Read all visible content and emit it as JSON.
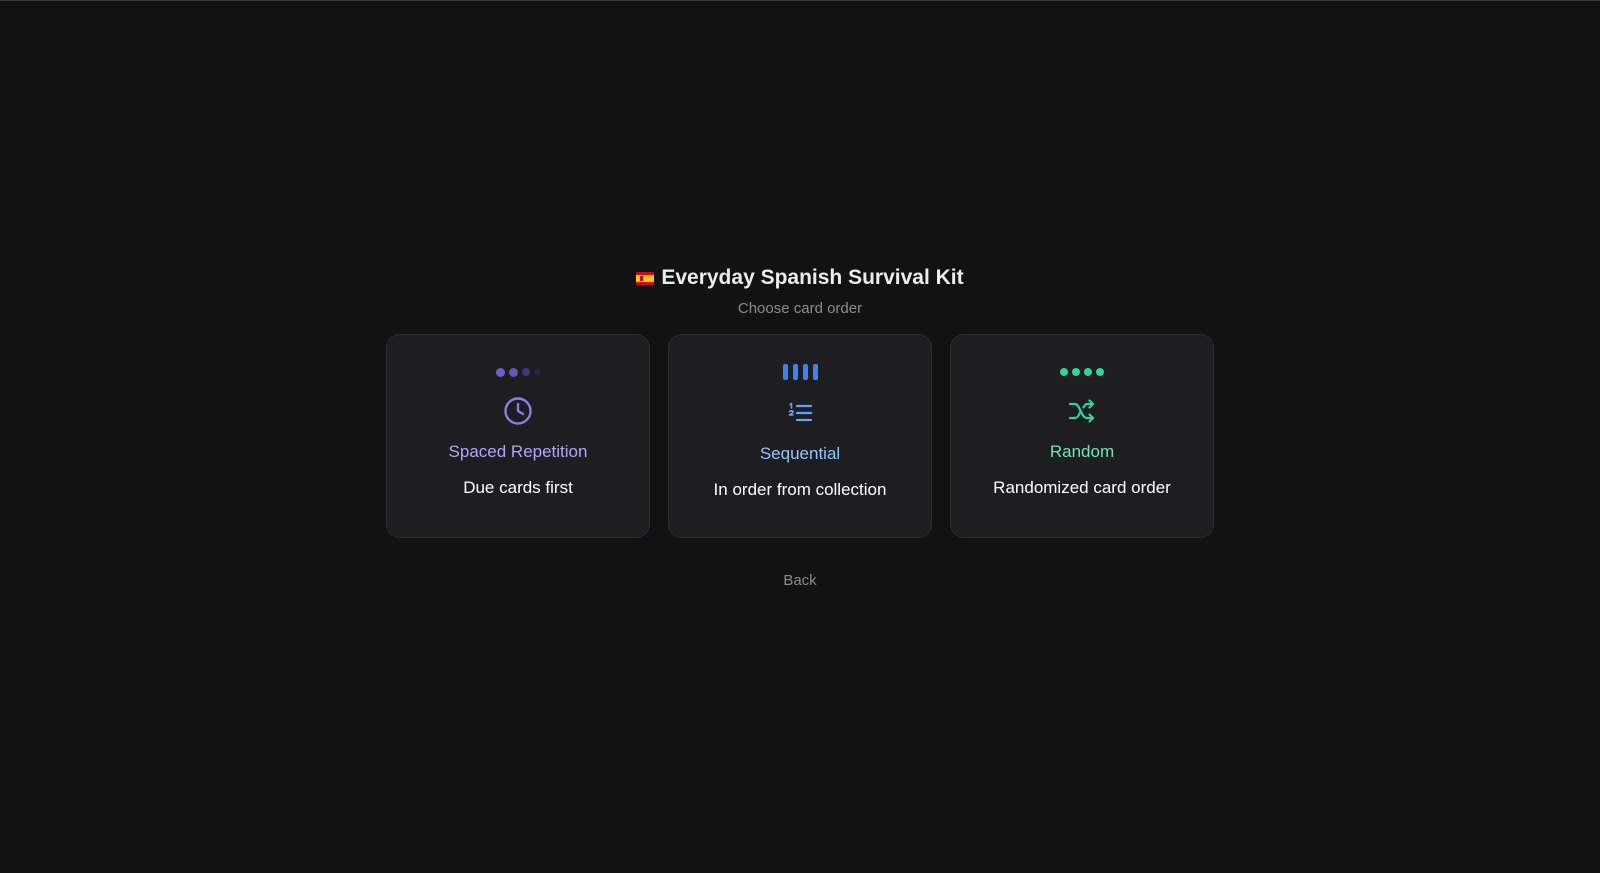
{
  "header": {
    "flag_icon": "spain-flag-icon",
    "title": "Everyday Spanish Survival Kit",
    "subtitle": "Choose card order"
  },
  "options": [
    {
      "title": "Spaced Repetition",
      "description": "Due cards first",
      "icon": "clock-icon",
      "accent": "#a78bfa",
      "icon_color": "#8b7cf0"
    },
    {
      "title": "Sequential",
      "description": "In order from collection",
      "icon": "numbered-list-icon",
      "accent": "#93c5fd",
      "icon_color": "#3b82f6"
    },
    {
      "title": "Random",
      "description": "Randomized card order",
      "icon": "shuffle-icon",
      "accent": "#6ee7b7",
      "icon_color": "#34d399"
    }
  ],
  "back_label": "Back"
}
